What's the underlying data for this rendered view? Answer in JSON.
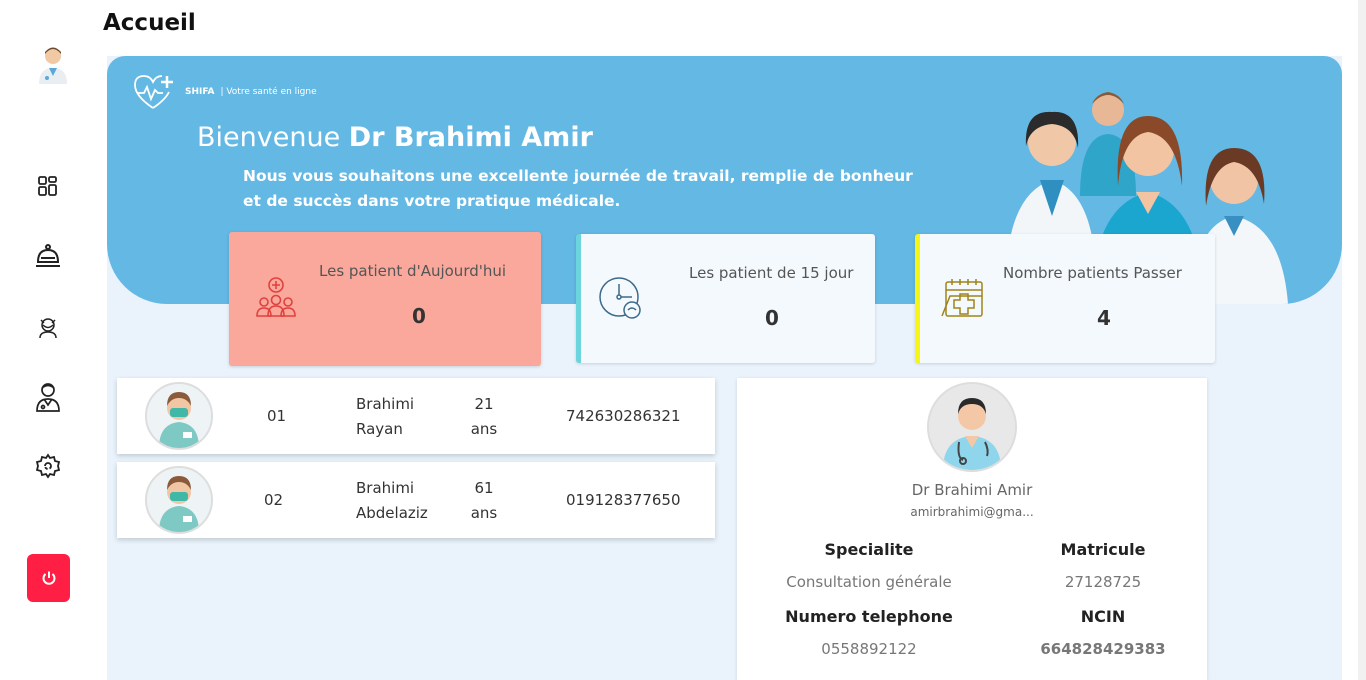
{
  "page": {
    "title": "Accueil"
  },
  "sidebar": {
    "icons": [
      "doctor-avatar",
      "dashboard-icon",
      "bell-icon",
      "patient-icon",
      "doctor-icon",
      "settings-icon"
    ],
    "logout_color": "#ff1f44"
  },
  "hero": {
    "brand_name": "SHIFA",
    "brand_tagline": "| Votre santé en ligne",
    "welcome_prefix": "Bienvenue",
    "doctor_name": "Dr Brahimi Amir",
    "subtitle": "Nous vous souhaitons une excellente journée de travail, remplie de bonheur et de succès dans votre pratique médicale.",
    "background": "#64b8e4"
  },
  "stats": [
    {
      "label": "Les patient d'Aujourd'hui",
      "value": "0",
      "accent": "#f9a89b"
    },
    {
      "label": "Les patient de 15 jour",
      "value": "0",
      "accent": "#6cd4dc"
    },
    {
      "label": "Nombre patients Passer",
      "value": "4",
      "accent": "#f5f517"
    }
  ],
  "patients": [
    {
      "num": "01",
      "first": "Brahimi",
      "last": "Rayan",
      "age": "21",
      "age_unit": "ans",
      "phone": "742630286321"
    },
    {
      "num": "02",
      "first": "Brahimi",
      "last": "Abdelaziz",
      "age": "61",
      "age_unit": "ans",
      "phone": "019128377650"
    }
  ],
  "profile": {
    "name": "Dr Brahimi Amir",
    "email": "amirbrahimi@gma...",
    "specialite_label": "Specialite",
    "specialite_value": "Consultation générale",
    "matricule_label": "Matricule",
    "matricule_value": "27128725",
    "phone_label": "Numero telephone",
    "phone_value": "0558892122",
    "ncin_label": "NCIN",
    "ncin_value": "664828429383"
  }
}
